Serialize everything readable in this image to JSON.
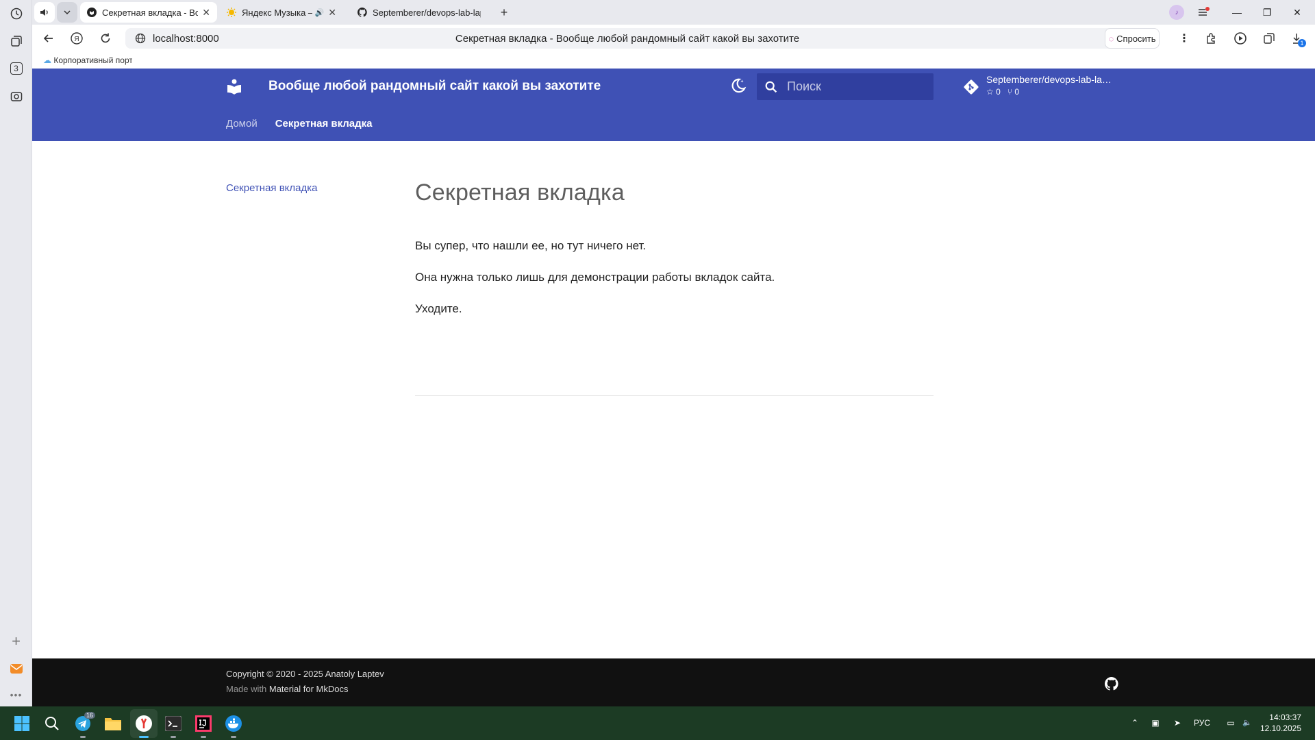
{
  "browser": {
    "tabs": [
      {
        "title": "Секретная вкладка - Вообще любой рандомный сайт какой вы захотите",
        "active": true
      },
      {
        "title": "Яндекс Музыка — собираем музыку для вас",
        "active": false
      },
      {
        "title": "Septemberer/devops-lab-laptev",
        "active": false
      }
    ],
    "side_badge": "3",
    "url": "localhost:8000",
    "page_title": "Секретная вкладка - Вообще любой рандомный сайт какой вы захотите",
    "ask_label": "Спросить",
    "downloads_badge": "1",
    "bookmark": "Корпоративный портал"
  },
  "site": {
    "title": "Вообще любой рандомный сайт какой вы захотите",
    "search_placeholder": "Поиск",
    "repo": {
      "name": "Septemberer/devops-lab-la…",
      "stars": "0",
      "forks": "0"
    },
    "tabs": [
      {
        "label": "Домой",
        "active": false
      },
      {
        "label": "Секретная вкладка",
        "active": true
      }
    ],
    "nav_item": "Секретная вкладка",
    "heading": "Секретная вкладка",
    "paragraphs": [
      "Вы супер, что нашли ее, но тут ничего нет.",
      "Она нужна только лишь для демонстрации работы вкладок сайта.",
      "Уходите."
    ],
    "footer": {
      "copyright": "Copyright © 2020 - 2025 Anatoly Laptev",
      "made_with": "Made with",
      "made_link": "Material for MkDocs"
    },
    "colors": {
      "primary": "#3f51b5",
      "search_bg": "#303f9f",
      "footer_bg": "#111111"
    }
  },
  "taskbar": {
    "telegram_badge": "16",
    "lang": "РУС",
    "time": "14:03:37",
    "date": "12.10.2025"
  }
}
